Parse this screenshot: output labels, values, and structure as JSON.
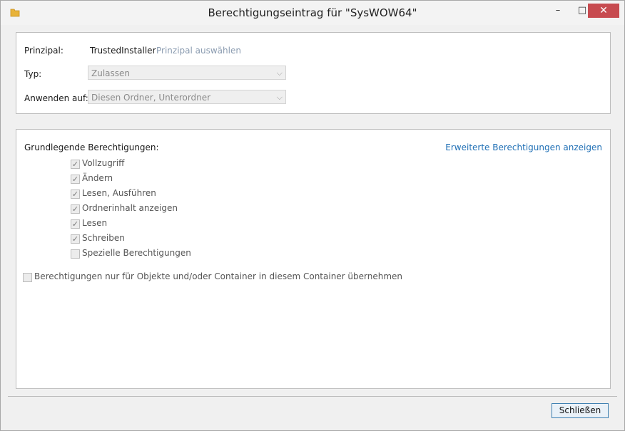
{
  "window": {
    "title": "Berechtigungseintrag für \"SysWOW64\"",
    "icon": "folder-icon",
    "controls": {
      "minimize": "–",
      "maximize": "□",
      "close": "✕"
    }
  },
  "principal": {
    "label": "Prinzipal:",
    "value": "TrustedInstaller",
    "select_link": "Prinzipal auswählen"
  },
  "type": {
    "label": "Typ:",
    "value": "Zulassen"
  },
  "apply_to": {
    "label": "Anwenden auf:",
    "value": "Diesen Ordner, Unterordner"
  },
  "permissions": {
    "heading": "Grundlegende Berechtigungen:",
    "advanced_link": "Erweiterte Berechtigungen anzeigen",
    "items": [
      {
        "label": "Vollzugriff",
        "checked": true
      },
      {
        "label": "Ändern",
        "checked": true
      },
      {
        "label": "Lesen, Ausführen",
        "checked": true
      },
      {
        "label": "Ordnerinhalt anzeigen",
        "checked": true
      },
      {
        "label": "Lesen",
        "checked": true
      },
      {
        "label": "Schreiben",
        "checked": true
      },
      {
        "label": "Spezielle Berechtigungen",
        "checked": false
      }
    ],
    "inherit_option": {
      "label": "Berechtigungen nur für Objekte und/oder Container in diesem Container übernehmen",
      "checked": false
    }
  },
  "footer": {
    "close_button": "Schließen"
  },
  "colors": {
    "link": "#1f6fb5",
    "disabled_link": "#8a9bb0",
    "close_control": "#c74b50"
  }
}
